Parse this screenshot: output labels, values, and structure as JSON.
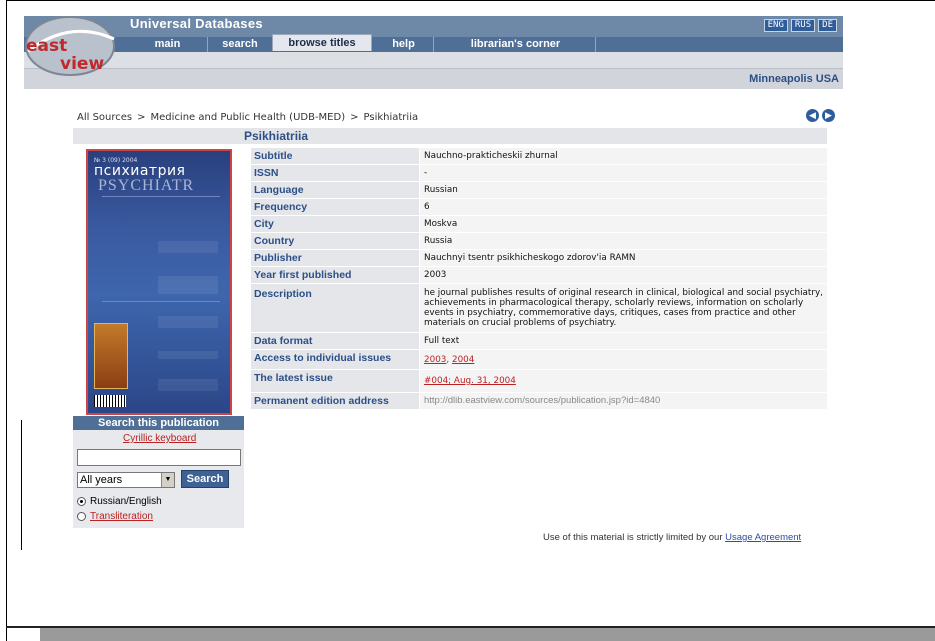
{
  "header": {
    "title": "Universal Databases",
    "tabs": [
      {
        "label": "main"
      },
      {
        "label": "search"
      },
      {
        "label": "browse titles"
      },
      {
        "label": "help"
      },
      {
        "label": "librarian's corner"
      }
    ],
    "languages": [
      "ENG",
      "RUS",
      "DE"
    ],
    "location": "Minneapolis USA",
    "logo_text": [
      "east",
      "view"
    ]
  },
  "breadcrumb": [
    "All Sources",
    ">",
    "Medicine and Public Health (UDB-MED)",
    ">",
    "Psikhiatriia"
  ],
  "page_title": "Psikhiatriia",
  "cover": {
    "top_text": "№ 3 (09) 2004",
    "title": "психиатрия",
    "subtitle": "PSYCHIATR"
  },
  "search": {
    "heading": "Search this publication",
    "cyrillic_link": "Cyrillic keyboard",
    "input_value": "",
    "year_selected": "All years",
    "button_label": "Search",
    "options": [
      "Russian/English",
      "Transliteration"
    ],
    "selected_option": "Russian/English"
  },
  "info_rows": [
    {
      "label": "Subtitle",
      "value": "Nauchno-prakticheskii zhurnal"
    },
    {
      "label": "ISSN",
      "value": "-"
    },
    {
      "label": "Language",
      "value": "Russian"
    },
    {
      "label": "Frequency",
      "value": "6"
    },
    {
      "label": "City",
      "value": "Moskva"
    },
    {
      "label": "Country",
      "value": "Russia"
    },
    {
      "label": "Publisher",
      "value": "Nauchnyi tsentr psikhicheskogo zdorov'ia RAMN"
    },
    {
      "label": "Year first published",
      "value": "2003"
    },
    {
      "label": "Description",
      "value": "he journal publishes results of original research in clinical, biological and social psychiatry, achievements in pharmacological therapy, scholarly reviews, information on scholarly events in psychiatry, commemorative days, critiques, cases from practice and other materials on crucial problems of psychiatry."
    },
    {
      "label": "Data format",
      "value": "Full text"
    },
    {
      "label": "Access to individual issues",
      "value": "2003, 2004"
    },
    {
      "label": "The latest issue",
      "value": "#004; Aug. 31, 2004"
    },
    {
      "label": "Permanent edition address",
      "value": "http://dlib.eastview.com/sources/publication.jsp?id=4840"
    }
  ],
  "access_links": [
    "2003",
    "2004"
  ],
  "footer": {
    "usage_text": "Use of this material is strictly limited by our",
    "usage_link": "Usage Agreement"
  },
  "colors": {
    "nav_blue": "#4f6f96",
    "label_blue": "#2b4f86",
    "link_red": "#b22222"
  }
}
